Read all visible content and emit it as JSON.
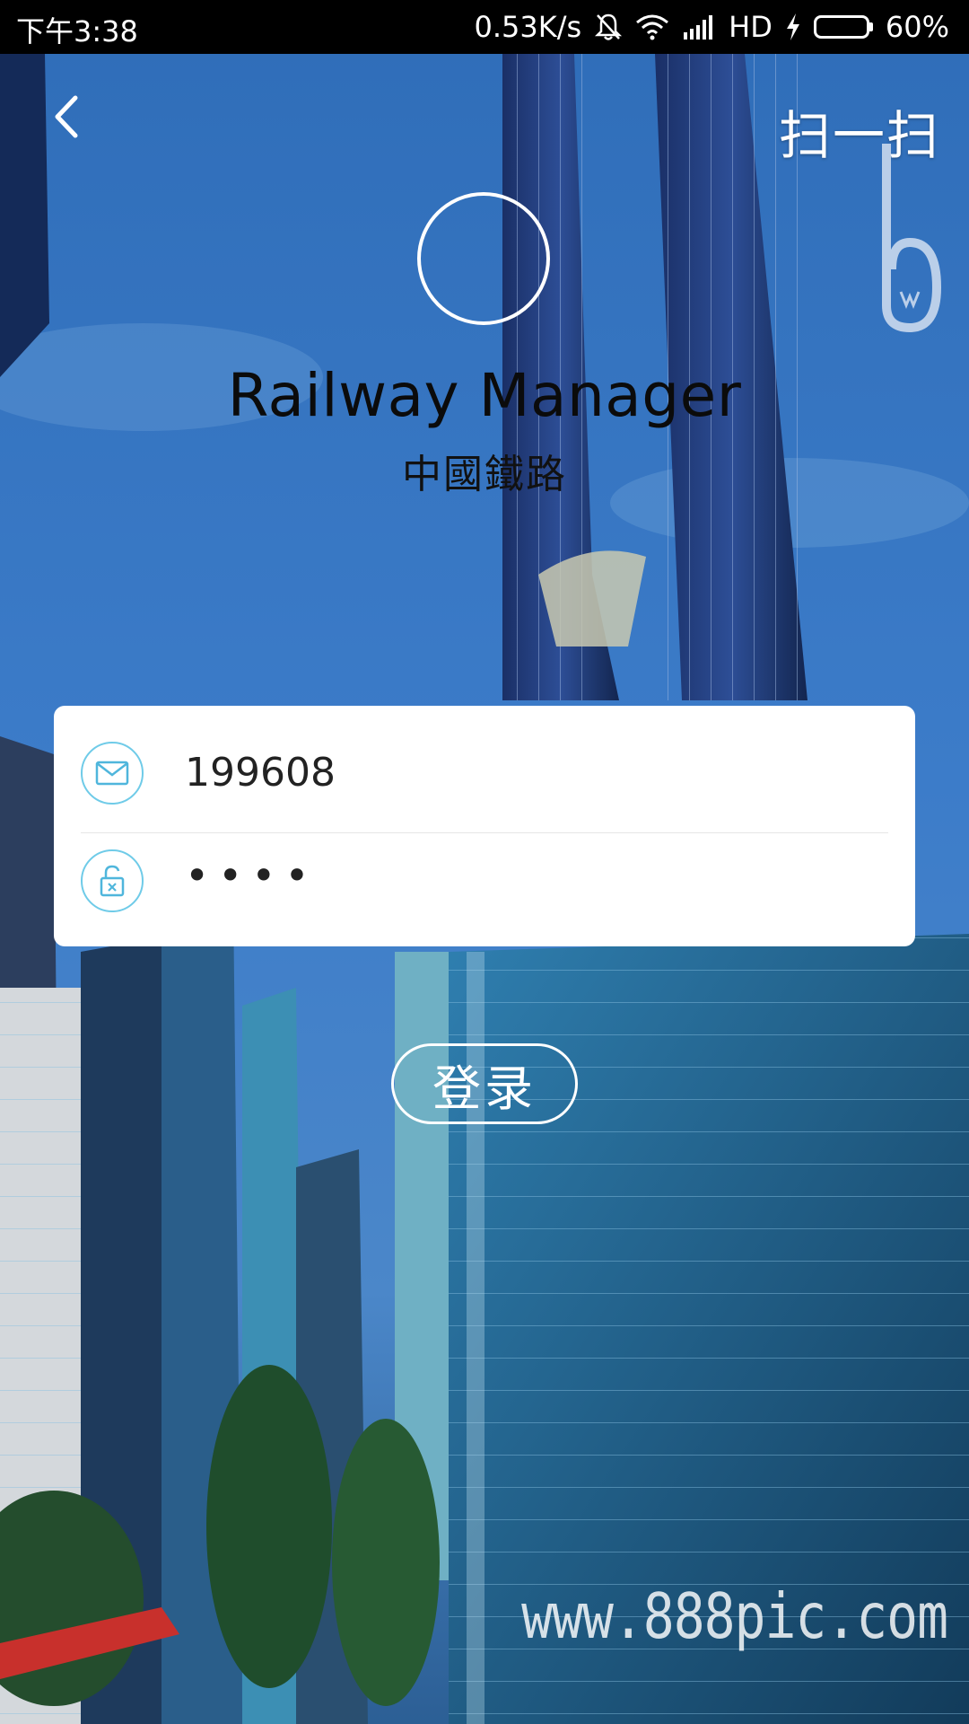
{
  "status_bar": {
    "time": "下午3:38",
    "net_speed": "0.53K/s",
    "network_type": "HD",
    "battery_percent": "60%",
    "battery_level": 0.6,
    "icons": [
      "mute-bell-icon",
      "wifi-icon",
      "signal-icon",
      "charging-bolt-icon",
      "battery-icon"
    ]
  },
  "header": {
    "back_icon": "chevron-left-icon",
    "scan_label": "扫一扫"
  },
  "app": {
    "title": "Railway Manager",
    "subtitle": "中國鐵路"
  },
  "login_form": {
    "username": {
      "icon": "mail-icon",
      "value": "199608"
    },
    "password": {
      "icon": "unlock-icon",
      "value": "••••"
    }
  },
  "login_button": {
    "label": "登录"
  },
  "watermark": "www.888pic.com",
  "colors": {
    "accent_icon_border": "#6fcbe8",
    "card_bg": "#ffffff",
    "status_bar_bg": "#000000",
    "battery_green": "#39d839"
  }
}
